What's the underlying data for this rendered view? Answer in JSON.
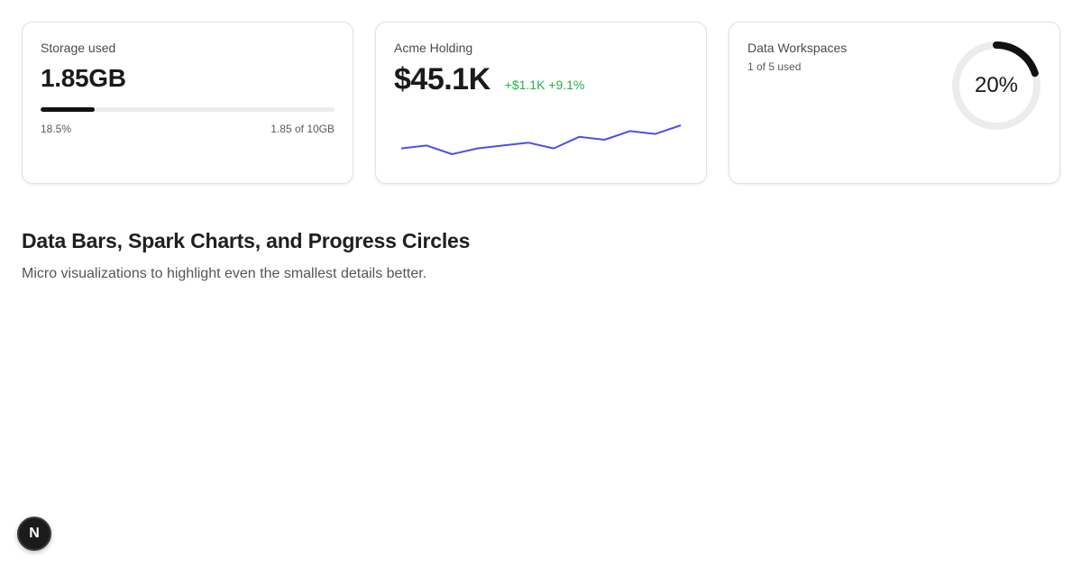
{
  "cards": {
    "storage": {
      "label": "Storage used",
      "value": "1.85GB",
      "progress": 0.185,
      "percent_label": "18.5%",
      "detail": "1.85 of 10GB"
    },
    "acme": {
      "label": "Acme Holding",
      "value": "$45.1K",
      "delta": "+$1.1K +9.1%",
      "delta_color": "#22b14c",
      "spark_color": "#4f4fe6",
      "spark_values": [
        22,
        23,
        20,
        22,
        23,
        24,
        22,
        26,
        25,
        28,
        27,
        30
      ]
    },
    "workspaces": {
      "label": "Data Workspaces",
      "subtitle": "1 of 5 used",
      "progress": 0.2,
      "percent_label": "20%"
    }
  },
  "section": {
    "title": "Data Bars, Spark Charts, and Progress Circles",
    "subtitle": "Micro visualizations to highlight even the smallest details better."
  },
  "badge": {
    "label": "N"
  }
}
